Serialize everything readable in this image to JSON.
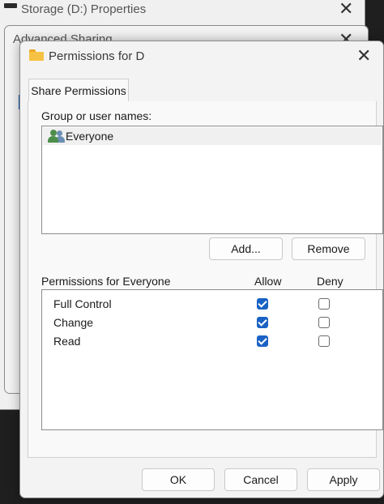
{
  "props_window": {
    "title": "Storage (D:) Properties",
    "close_glyph": "✕"
  },
  "adv_window": {
    "title": "Advanced Sharing",
    "close_glyph": "✕"
  },
  "perm_window": {
    "title": "Permissions for D",
    "close_glyph": "✕",
    "tab_label": "Share Permissions",
    "group_label": "Group or user names:",
    "users": [
      {
        "name": "Everyone",
        "icon": "users-icon"
      }
    ],
    "add_label": "Add...",
    "remove_label": "Remove",
    "perm_header": "Permissions for Everyone",
    "allow_header": "Allow",
    "deny_header": "Deny",
    "permissions": [
      {
        "name": "Full Control",
        "allow": true,
        "deny": false
      },
      {
        "name": "Change",
        "allow": true,
        "deny": false
      },
      {
        "name": "Read",
        "allow": true,
        "deny": false
      }
    ],
    "ok_label": "OK",
    "cancel_label": "Cancel",
    "apply_label": "Apply"
  },
  "colors": {
    "accent": "#1a62c4",
    "folder": "#f5c243"
  }
}
